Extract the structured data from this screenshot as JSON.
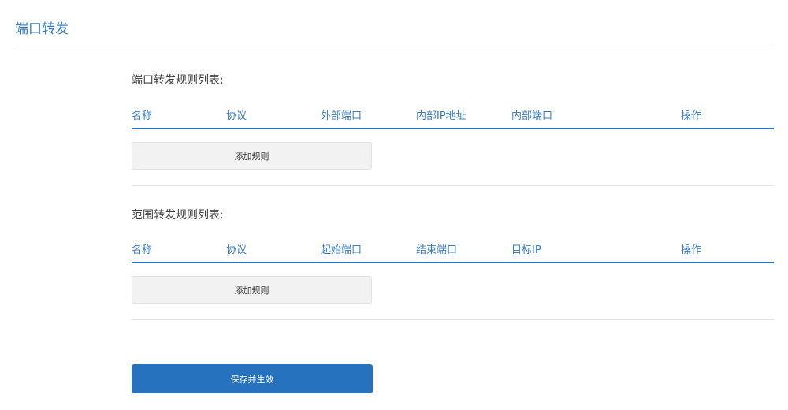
{
  "page": {
    "title": "端口转发"
  },
  "port_rules": {
    "title": "端口转发规则列表:",
    "columns": [
      "名称",
      "协议",
      "外部端口",
      "内部IP地址",
      "内部端口",
      "操作"
    ],
    "add_label": "添加规则"
  },
  "range_rules": {
    "title": "范围转发规则列表:",
    "columns": [
      "名称",
      "协议",
      "起始端口",
      "结束端口",
      "目标IP",
      "操作"
    ],
    "add_label": "添加规则"
  },
  "save_label": "保存并生效"
}
